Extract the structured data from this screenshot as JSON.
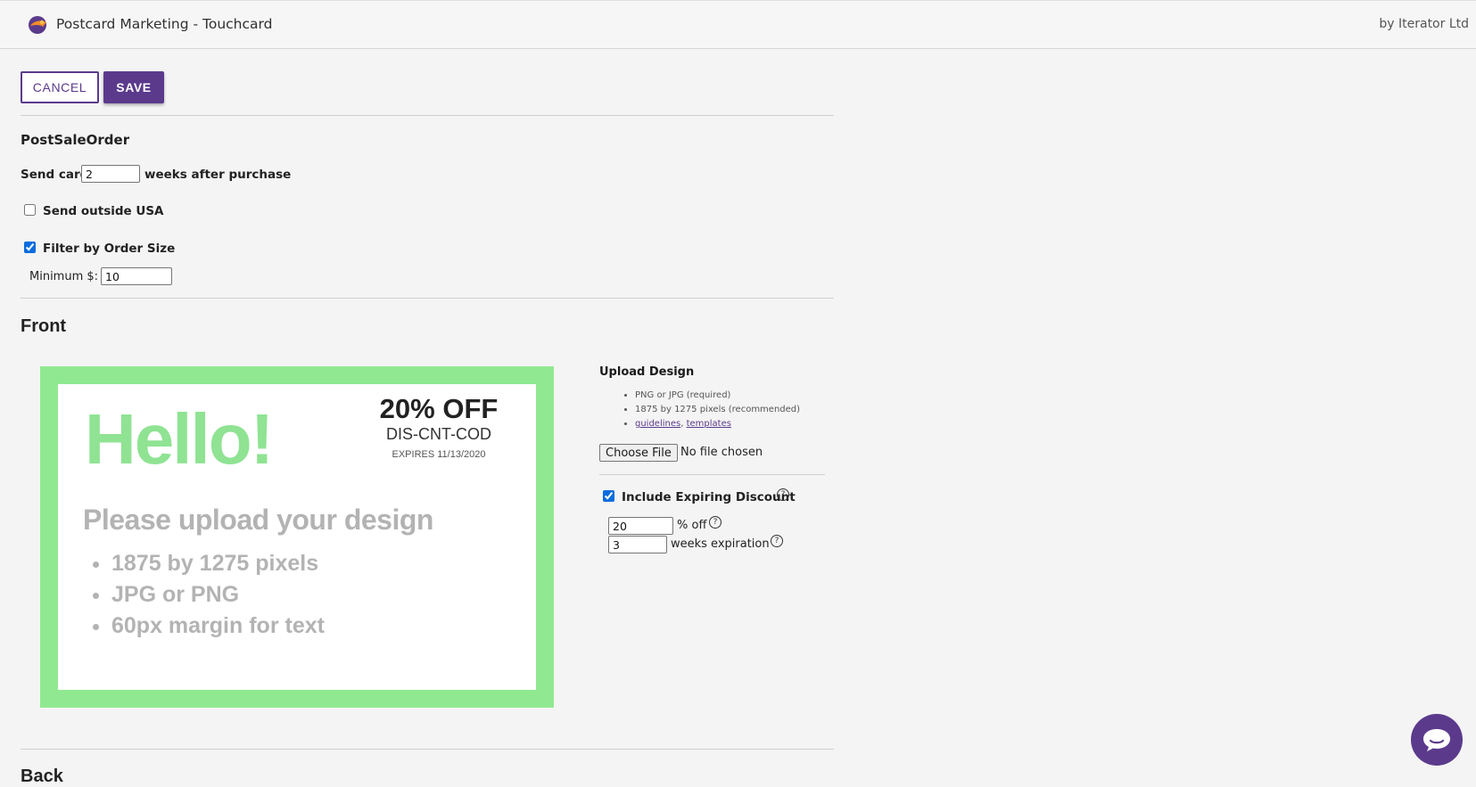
{
  "header": {
    "title": "Postcard Marketing - Touchcard",
    "byline": "by Iterator Ltd",
    "logo_icon": "touchcard-logo-icon"
  },
  "actions": {
    "cancel_label": "CANCEL",
    "save_label": "SAVE"
  },
  "settings": {
    "name": "PostSaleOrder",
    "send_prefix": "Send card",
    "send_weeks": "2",
    "send_suffix": "weeks after purchase",
    "outside_usa_label": "Send outside USA",
    "outside_usa_checked": false,
    "filter_label": "Filter by Order Size",
    "filter_checked": true,
    "minimum_label": "Minimum $:",
    "minimum_value": "10"
  },
  "front": {
    "heading": "Front",
    "postcard": {
      "greeting": "Hello!",
      "discount_pct": "20% OFF",
      "discount_code": "DIS-CNT-COD",
      "expires": "EXPIRES 11/13/2020",
      "upload_message": "Please upload your design",
      "bullets": [
        "1875 by 1275 pixels",
        "JPG or PNG",
        "60px margin for text"
      ]
    },
    "upload": {
      "title": "Upload Design",
      "requirements": [
        "PNG or JPG (required)",
        "1875 by 1275 pixels (recommended)"
      ],
      "link_guidelines": "guidelines",
      "link_separator": ", ",
      "link_templates": "templates",
      "choose_file_label": "Choose File",
      "file_status": "No file chosen"
    },
    "discount": {
      "include_label": "Include Expiring Discount",
      "include_checked": true,
      "percent_value": "20",
      "percent_suffix": "% off",
      "weeks_value": "3",
      "weeks_suffix": "weeks expiration"
    }
  },
  "back": {
    "heading": "Back"
  },
  "colors": {
    "brand_purple": "#5b3a8c",
    "postcard_green": "#90e991",
    "background": "#f4f4f4"
  },
  "chat": {
    "icon": "chat-bubble-icon"
  }
}
